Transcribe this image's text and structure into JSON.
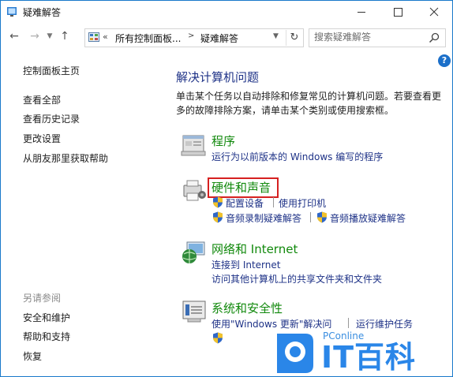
{
  "window": {
    "title": "疑难解答",
    "accent": "#1979ca"
  },
  "address": {
    "prefix": "«",
    "crumbs": [
      "所有控制面板...",
      "疑难解答"
    ],
    "separator": ">"
  },
  "search": {
    "placeholder": "搜索疑难解答"
  },
  "left_nav": {
    "home": "控制面板主页",
    "links": [
      "查看全部",
      "查看历史记录",
      "更改设置",
      "从朋友那里获取帮助"
    ],
    "see_also_header": "另请参阅",
    "see_also": [
      "安全和维护",
      "帮助和支持",
      "恢复"
    ]
  },
  "main": {
    "title": "解决计算机问题",
    "description": "单击某个任务以自动排除和修复常见的计算机问题。若要查看更多的故障排除方案，请单击某个类别或使用搜索框。",
    "categories": [
      {
        "title": "程序",
        "icon": "programs-icon",
        "links": [
          "运行为以前版本的 Windows 编写的程序"
        ]
      },
      {
        "title": "硬件和声音",
        "icon": "hardware-sound-icon",
        "links": [
          "配置设备",
          "使用打印机",
          "音频录制疑难解答",
          "音频播放疑难解答"
        ]
      },
      {
        "title": "网络和 Internet",
        "icon": "network-icon",
        "links": [
          "连接到 Internet",
          "访问其他计算机上的共享文件夹和文件夹"
        ]
      },
      {
        "title": "系统和安全性",
        "icon": "system-security-icon",
        "links": [
          "使用\"Windows 更新\"解决问",
          "运行维护任务"
        ]
      }
    ]
  },
  "watermark": {
    "brand": "PConline",
    "text": "IT百科",
    "color": "#2a86e8"
  },
  "colors": {
    "link": "#1e3287",
    "category": "#11890c",
    "highlight": "#d62020"
  }
}
